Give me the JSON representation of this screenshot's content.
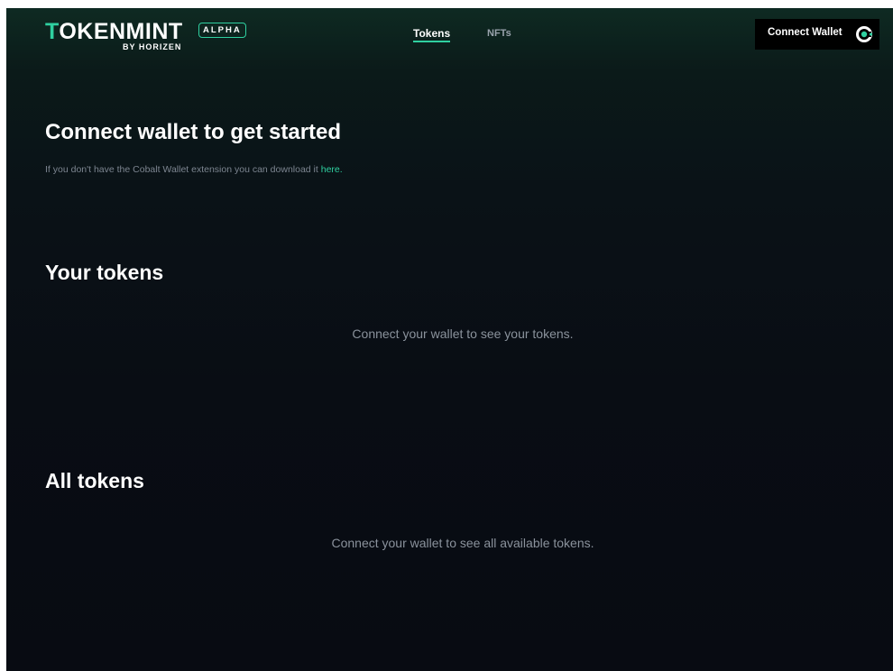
{
  "header": {
    "logo_wordmark_first": "T",
    "logo_wordmark_rest": "OKENMINT",
    "logo_sub": "BY HORIZEN",
    "badge": "ALPHA",
    "nav": [
      {
        "label": "Tokens",
        "active": true
      },
      {
        "label": "NFTs",
        "active": false
      }
    ],
    "connect_label": "Connect Wallet",
    "connect_icon": "cobalt-wallet-icon"
  },
  "hero": {
    "title": "Connect wallet to get started",
    "subtitle_prefix": "If you don't have the Cobalt Wallet extension you can download it ",
    "subtitle_link": "here."
  },
  "your_tokens": {
    "title": "Your tokens",
    "empty_message": "Connect your wallet to see your tokens."
  },
  "all_tokens": {
    "title": "All tokens",
    "empty_message": "Connect your wallet to see all available tokens."
  },
  "colors": {
    "accent": "#2fd0a0",
    "background": "#080b12",
    "muted_text": "#8a929c"
  }
}
